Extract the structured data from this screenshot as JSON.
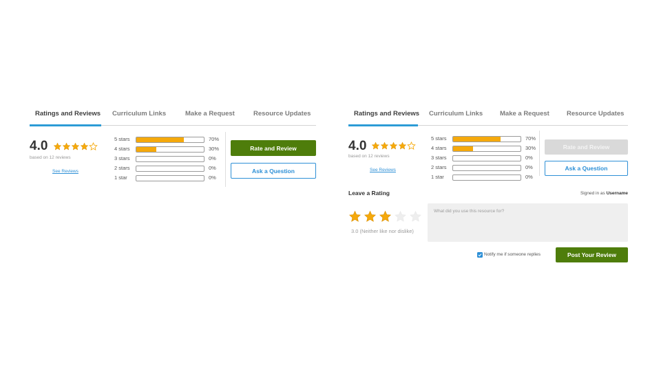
{
  "colors": {
    "accent_blue": "#2c9bd6",
    "link_blue": "#2c8fd6",
    "brand_green": "#4e7d0b",
    "star_gold": "#f5a90c",
    "disabled_gray": "#d9d9d9"
  },
  "left": {
    "tabs": [
      {
        "label": "Ratings and Reviews",
        "active": true
      },
      {
        "label": "Curriculum Links",
        "active": false
      },
      {
        "label": "Make a Request",
        "active": false
      },
      {
        "label": "Resource Updates",
        "active": false
      }
    ],
    "summary": {
      "rating": "4.0",
      "stars_filled": 4,
      "stars_total": 5,
      "based_on": "based on 12 reviews",
      "see_reviews": "See Reviews"
    },
    "distribution": [
      {
        "label": "5 stars",
        "percent": 70,
        "percent_label": "70%"
      },
      {
        "label": "4 stars",
        "percent": 30,
        "percent_label": "30%"
      },
      {
        "label": "3 stars",
        "percent": 0,
        "percent_label": "0%"
      },
      {
        "label": "2 stars",
        "percent": 0,
        "percent_label": "0%"
      },
      {
        "label": "1 star",
        "percent": 0,
        "percent_label": "0%"
      }
    ],
    "buttons": {
      "rate_review": "Rate and Review",
      "ask_question": "Ask a Question"
    }
  },
  "right": {
    "tabs": [
      {
        "label": "Ratings and Reviews",
        "active": true
      },
      {
        "label": "Curriculum Links",
        "active": false
      },
      {
        "label": "Make a Request",
        "active": false
      },
      {
        "label": "Resource Updates",
        "active": false
      }
    ],
    "summary": {
      "rating": "4.0",
      "stars_filled": 4,
      "stars_total": 5,
      "based_on": "based on 12 reviews",
      "see_reviews": "See Reviews"
    },
    "distribution": [
      {
        "label": "5 stars",
        "percent": 70,
        "percent_label": "70%"
      },
      {
        "label": "4 stars",
        "percent": 30,
        "percent_label": "30%"
      },
      {
        "label": "3 stars",
        "percent": 0,
        "percent_label": "0%"
      },
      {
        "label": "2 stars",
        "percent": 0,
        "percent_label": "0%"
      },
      {
        "label": "1 star",
        "percent": 0,
        "percent_label": "0%"
      }
    ],
    "buttons": {
      "rate_review": "Rate and Review",
      "rate_review_disabled": true,
      "ask_question": "Ask a Question"
    },
    "leave_rating": {
      "title": "Leave a Rating",
      "signed_in_prefix": "Signed in as",
      "username": "Username",
      "selected_stars": 3,
      "total_stars": 5,
      "caption": "3.0 (Neither like nor dislike)",
      "placeholder": "What did you use this resource for?",
      "notify_label": "Notify me if someone replies",
      "notify_checked": true,
      "post_button": "Post Your Review"
    }
  }
}
